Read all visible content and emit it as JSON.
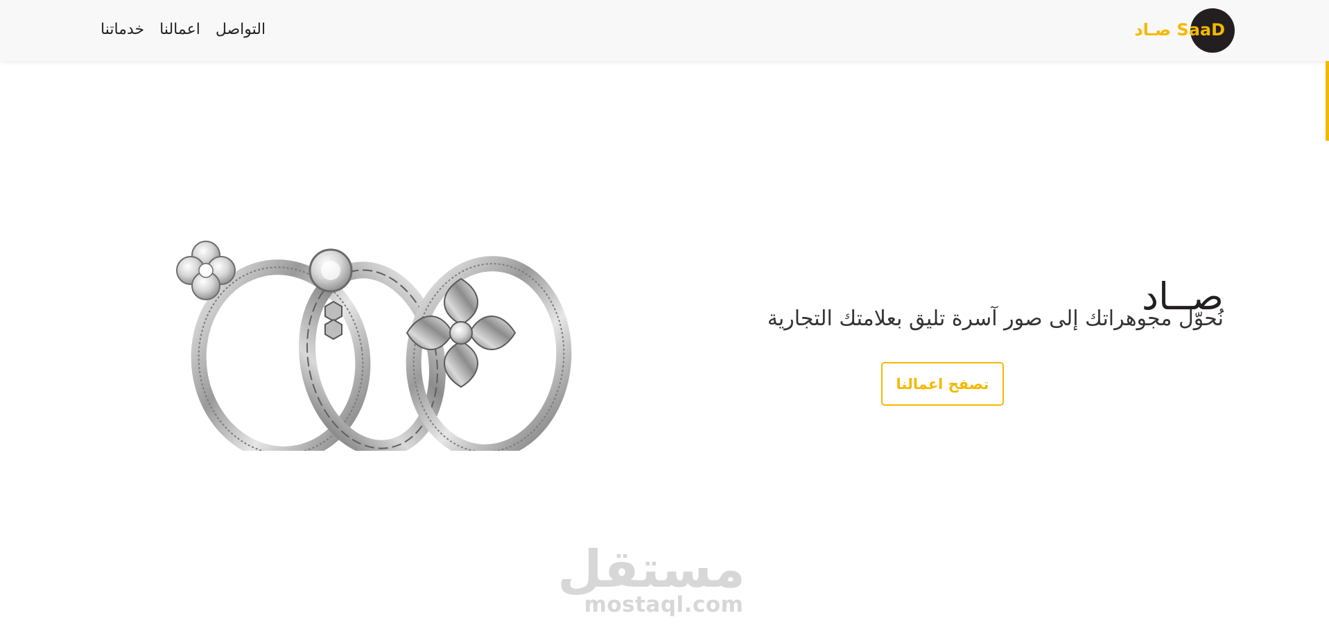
{
  "nav": {
    "brand": "صـاد SaaD",
    "links": [
      "خدماتنا",
      "اعمالنا",
      "التواصل"
    ]
  },
  "hero": {
    "title": "صــاد",
    "subtitle": "نُحوّل مجوهراتك إلى صور آسرة تليق بعلامتك التجارية",
    "button_label": "تصفح اعمالنا"
  },
  "watermark": {
    "arabic": "مستقل",
    "latin": "mostaql.com"
  },
  "colors": {
    "accent": "#f5b800",
    "dark": "#231f20",
    "nav_bg": "#f8f8f8"
  }
}
